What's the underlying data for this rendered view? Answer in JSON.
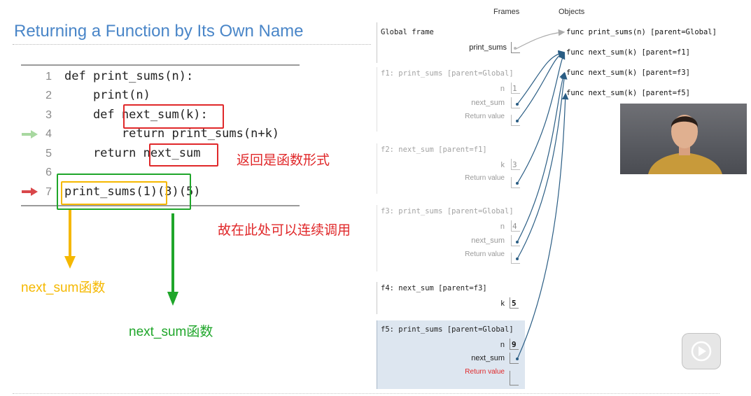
{
  "slide": {
    "title": "Returning a Function by Its Own Name"
  },
  "code": {
    "lines": [
      {
        "no": "1",
        "text": "def print_sums(n):"
      },
      {
        "no": "2",
        "text": "    print(n)"
      },
      {
        "no": "3",
        "text": "    def next_sum(k):"
      },
      {
        "no": "4",
        "text": "        return print_sums(n+k)"
      },
      {
        "no": "5",
        "text": "    return next_sum"
      },
      {
        "no": "6",
        "text": ""
      },
      {
        "no": "7",
        "text": "print_sums(1)(3)(5)"
      }
    ]
  },
  "annotations": {
    "returns_function": "返回是函数形式",
    "chain_calls": "故在此处可以连续调用",
    "yellow_label": "next_sum函数",
    "green_label": "next_sum函数"
  },
  "colors": {
    "red": "#e0282a",
    "yellow": "#f5b800",
    "green": "#1fa62a",
    "title_blue": "#4a86c8",
    "arrow_blue": "#2a5d84",
    "active_frame": "#dde6f0"
  },
  "viz": {
    "frames_header": "Frames",
    "objects_header": "Objects",
    "global_frame": {
      "title": "Global frame",
      "var": "print_sums"
    },
    "frames": [
      {
        "title": "f1: print_sums [parent=Global]",
        "vars": [
          {
            "name": "n",
            "value": "1"
          },
          {
            "name": "next_sum",
            "value": ""
          },
          {
            "name": "Return value",
            "value": ""
          }
        ]
      },
      {
        "title": "f2: next_sum [parent=f1]",
        "vars": [
          {
            "name": "k",
            "value": "3"
          },
          {
            "name": "Return value",
            "value": ""
          }
        ]
      },
      {
        "title": "f3: print_sums [parent=Global]",
        "vars": [
          {
            "name": "n",
            "value": "4"
          },
          {
            "name": "next_sum",
            "value": ""
          },
          {
            "name": "Return value",
            "value": ""
          }
        ]
      },
      {
        "title": "f4: next_sum [parent=f3]",
        "vars": [
          {
            "name": "k",
            "value": "5"
          }
        ]
      },
      {
        "title": "f5: print_sums [parent=Global]",
        "vars": [
          {
            "name": "n",
            "value": "9"
          },
          {
            "name": "next_sum",
            "value": ""
          },
          {
            "name": "Return value",
            "value": ""
          }
        ]
      }
    ],
    "objects": [
      "func print_sums(n) [parent=Global]",
      "func next_sum(k) [parent=f1]",
      "func next_sum(k) [parent=f3]",
      "func next_sum(k) [parent=f5]"
    ]
  },
  "player": {
    "play_icon": "play-icon"
  }
}
